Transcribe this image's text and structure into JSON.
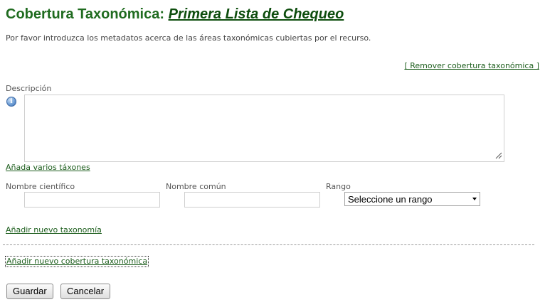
{
  "header": {
    "title_prefix": "Cobertura Taxonómica:",
    "title_link": "Primera Lista de Chequeo",
    "intro": "Por favor introduzca los metadatos acerca de las áreas taxonómicas cubiertas por el recurso."
  },
  "coverage": {
    "remove_link": "[ Remover cobertura taxonómica ]",
    "description_label": "Descripción",
    "description_value": "",
    "info_icon": "info-icon",
    "add_many_taxa_link": "Añada varios táxones",
    "scientific_name_label": "Nombre científico",
    "scientific_name_value": "",
    "common_name_label": "Nombre común",
    "common_name_value": "",
    "rank_label": "Rango",
    "rank_selected": "Seleccione un rango",
    "add_taxonomy_link": "Añadir nuevo taxonomía"
  },
  "footer": {
    "add_coverage_link": "Añadir nuevo cobertura taxonómica",
    "save_label": "Guardar",
    "cancel_label": "Cancelar"
  },
  "colors": {
    "title_green": "#1f6b1f",
    "link_green": "#1d5e1d"
  }
}
